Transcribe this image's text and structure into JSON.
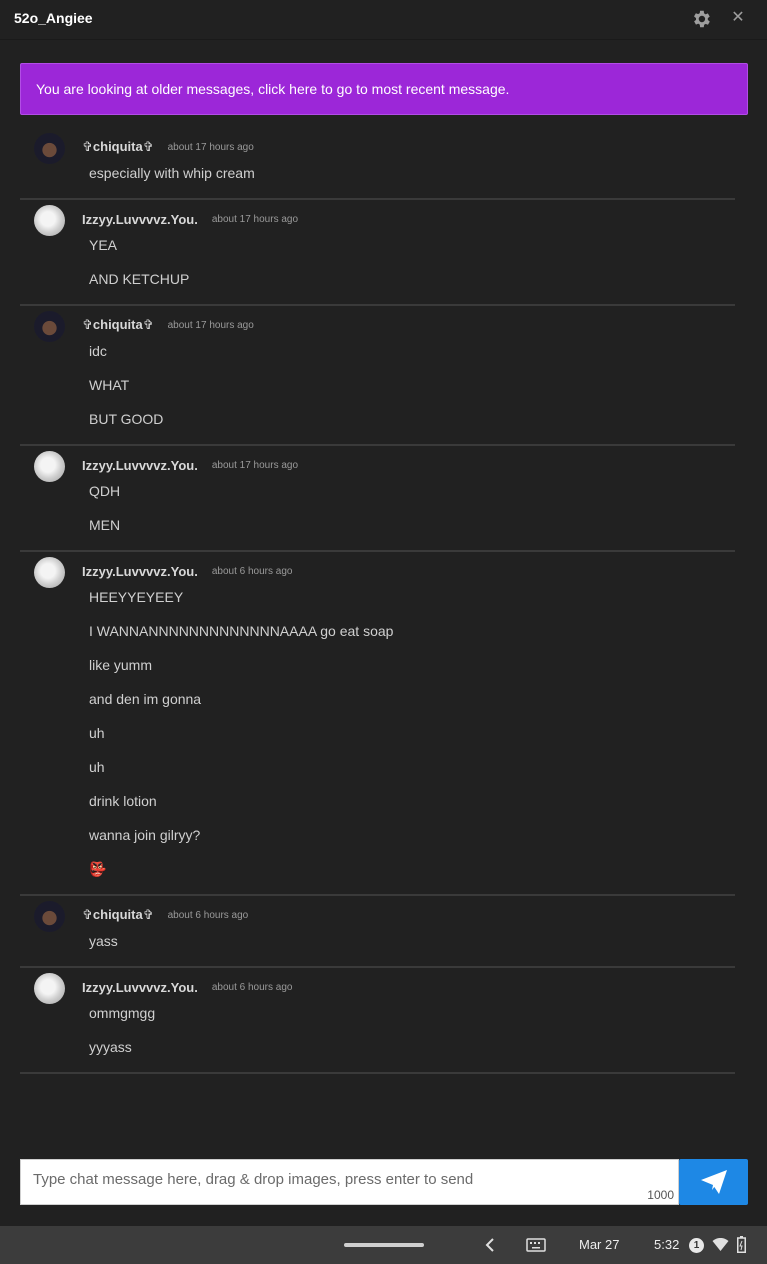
{
  "window": {
    "title": "52o_Angiee"
  },
  "banner": {
    "text": "You are looking at older messages, click here to go to most recent message."
  },
  "messages": [
    {
      "user": "✞chiquita✞",
      "time": "about 17 hours ago",
      "avatar": "dark",
      "lines": [
        "especially with whip cream"
      ]
    },
    {
      "user": "Izzyy.Luvvvvz.You.",
      "time": "about 17 hours ago",
      "avatar": "light",
      "lines": [
        "YEA",
        "AND KETCHUP"
      ]
    },
    {
      "user": "✞chiquita✞",
      "time": "about 17 hours ago",
      "avatar": "dark",
      "lines": [
        "idc",
        "WHAT",
        "BUT GOOD"
      ]
    },
    {
      "user": "Izzyy.Luvvvvz.You.",
      "time": "about 17 hours ago",
      "avatar": "light",
      "lines": [
        "QDH",
        "MEN"
      ]
    },
    {
      "user": "Izzyy.Luvvvvz.You.",
      "time": "about 6 hours ago",
      "avatar": "light",
      "lines": [
        "HEEYYEYEEY",
        "I WANNANNNNNNNNNNNNNAAAA go eat soap",
        "like yumm",
        "and den im gonna",
        "uh",
        "uh",
        "drink lotion",
        "wanna join gilryy?",
        "👺"
      ]
    },
    {
      "user": "✞chiquita✞",
      "time": "about 6 hours ago",
      "avatar": "dark",
      "lines": [
        "yass"
      ]
    },
    {
      "user": "Izzyy.Luvvvvz.You.",
      "time": "about 6 hours ago",
      "avatar": "light",
      "lines": [
        "ommgmgg",
        "yyyass"
      ]
    }
  ],
  "composer": {
    "placeholder": "Type chat message here, drag & drop images, press enter to send",
    "counter": "1000"
  },
  "shelf": {
    "date": "Mar 27",
    "time": "5:32",
    "notification_count": "1"
  },
  "icons": {
    "settings": "gear-icon",
    "close": "close-icon",
    "send": "send-icon",
    "back": "chevron-left-icon",
    "keyboard": "keyboard-icon",
    "wifi": "wifi-icon",
    "battery": "battery-icon"
  },
  "colors": {
    "background": "#212121",
    "banner": "#9c27d8",
    "send_button": "#1e88e5",
    "shelf": "#3c3c3c"
  }
}
